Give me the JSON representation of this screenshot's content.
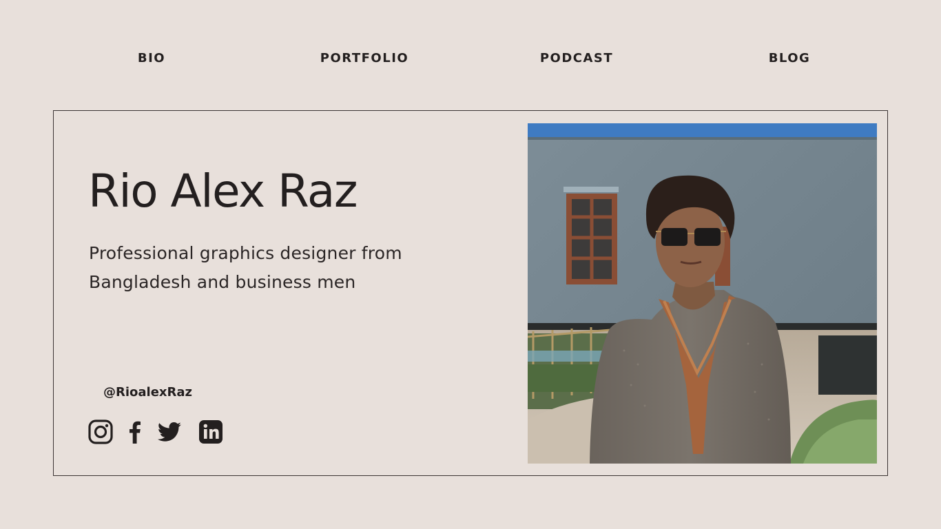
{
  "nav": {
    "items": [
      {
        "label": "BIO"
      },
      {
        "label": "PORTFOLIO"
      },
      {
        "label": "PODCAST"
      },
      {
        "label": "BLOG"
      }
    ]
  },
  "profile": {
    "name": "Rio Alex Raz",
    "tagline_line1": "Professional graphics designer from",
    "tagline_line2": "Bangladesh and  business men",
    "handle": "@RioalexRaz"
  },
  "social": {
    "icons": [
      "instagram-icon",
      "facebook-icon",
      "twitter-icon",
      "linkedin-icon"
    ]
  },
  "colors": {
    "background": "#e8e0db",
    "text": "#231f1f",
    "border": "#3a3333"
  }
}
